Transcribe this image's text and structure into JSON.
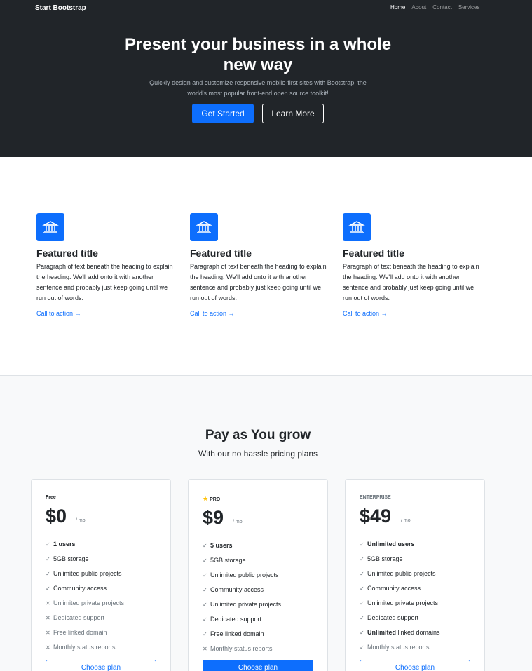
{
  "navbar": {
    "brand": "Start Bootstrap",
    "links": [
      "Home",
      "About",
      "Contact",
      "Services"
    ]
  },
  "hero": {
    "title": "Present your business in a whole new way",
    "lead": "Quickly design and customize responsive mobile-first sites with Bootstrap, the world's most popular front-end open source toolkit!",
    "primary_button": "Get Started",
    "secondary_button": "Learn More"
  },
  "features": [
    {
      "title": "Featured title",
      "text": "Paragraph of text beneath the heading to explain the heading. We'll add onto it with another sentence and probably just keep going until we run out of words.",
      "link": "Call to action →",
      "icon": "bank-icon"
    },
    {
      "title": "Featured title",
      "text": "Paragraph of text beneath the heading to explain the heading. We'll add onto it with another sentence and probably just keep going until we run out of words.",
      "link": "Call to action →",
      "icon": "bank-icon"
    },
    {
      "title": "Featured title",
      "text": "Paragraph of text beneath the heading to explain the heading. We'll add onto it with another sentence and probably just keep going until we run out of words.",
      "link": "Call to action →",
      "icon": "bank-icon"
    }
  ],
  "pricing": {
    "title": "Pay as You grow",
    "subtitle": "With our no hassle pricing plans",
    "plans": [
      {
        "name": "Free",
        "price": "$0",
        "per": "/ mo.",
        "button": "Choose plan",
        "items": [
          {
            "text": "1 users",
            "included": true,
            "bold": true
          },
          {
            "text": "5GB storage",
            "included": true
          },
          {
            "text": "Unlimited public projects",
            "included": true
          },
          {
            "text": "Community access",
            "included": true
          },
          {
            "text": "Unlimited private projects",
            "included": false
          },
          {
            "text": "Dedicated support",
            "included": false
          },
          {
            "text": "Free linked domain",
            "included": false
          },
          {
            "text": "Monthly status reports",
            "included": false
          }
        ]
      },
      {
        "name": "PRO",
        "price": "$9",
        "per": "/ mo.",
        "button": "Choose plan",
        "items": [
          {
            "text": "5 users",
            "included": true,
            "bold": true
          },
          {
            "text": "5GB storage",
            "included": true
          },
          {
            "text": "Unlimited public projects",
            "included": true
          },
          {
            "text": "Community access",
            "included": true
          },
          {
            "text": "Unlimited private projects",
            "included": true
          },
          {
            "text": "Dedicated support",
            "included": true
          },
          {
            "text": "Free linked domain",
            "included": true
          },
          {
            "text": "Monthly status reports",
            "included": false
          }
        ]
      },
      {
        "name": "ENTERPRISE",
        "price": "$49",
        "per": "/ mo.",
        "button": "Choose plan",
        "items": [
          {
            "text": "Unlimited users",
            "included": true,
            "bold": true
          },
          {
            "text": "5GB storage",
            "included": true
          },
          {
            "text": "Unlimited public projects",
            "included": true
          },
          {
            "text": "Community access",
            "included": true
          },
          {
            "text": "Unlimited private projects",
            "included": true
          },
          {
            "text": "Dedicated support",
            "included": true
          },
          {
            "text_bold": "Unlimited",
            "text": " linked domains",
            "included": true
          },
          {
            "text": "Monthly status reports",
            "included": true,
            "muted": true
          }
        ]
      }
    ]
  },
  "colors": {
    "primary": "#0d6efd",
    "dark": "#212529",
    "muted": "#6c757d",
    "star": "#ffc107"
  }
}
